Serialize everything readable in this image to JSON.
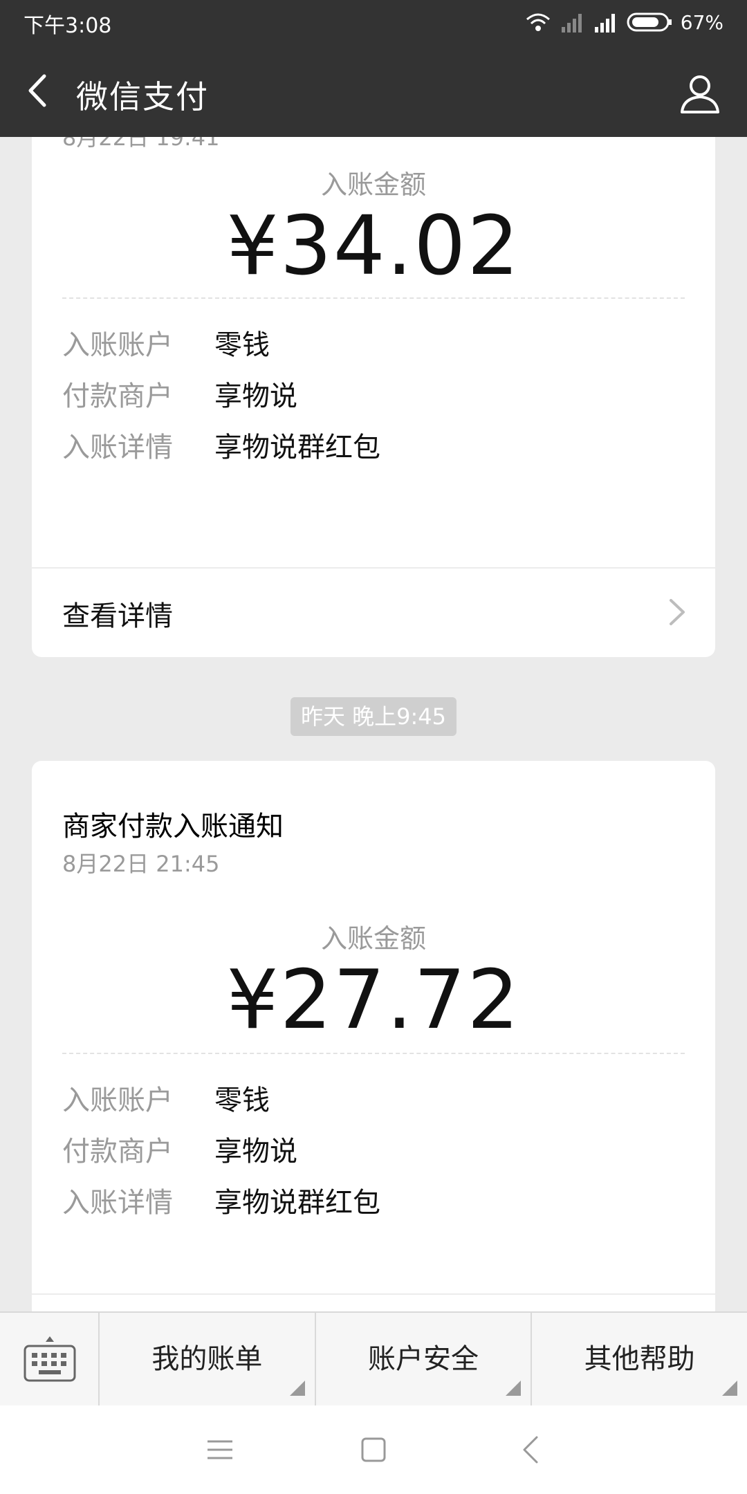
{
  "status": {
    "time": "下午3:08",
    "battery": "67%"
  },
  "header": {
    "title": "微信支付"
  },
  "cards": [
    {
      "partial_date": "8月22日 19:41",
      "amount_label": "入账金额",
      "amount": "¥34.02",
      "rows": [
        {
          "key": "入账账户",
          "value": "零钱"
        },
        {
          "key": "付款商户",
          "value": "享物说"
        },
        {
          "key": "入账详情",
          "value": "享物说群红包"
        }
      ],
      "detail_link": "查看详情"
    },
    {
      "title": "商家付款入账通知",
      "date": "8月22日 21:45",
      "amount_label": "入账金额",
      "amount": "¥27.72",
      "rows": [
        {
          "key": "入账账户",
          "value": "零钱"
        },
        {
          "key": "付款商户",
          "value": "享物说"
        },
        {
          "key": "入账详情",
          "value": "享物说群红包"
        }
      ]
    }
  ],
  "timestamp_pill": "昨天 晚上9:45",
  "menu": {
    "items": [
      "我的账单",
      "账户安全",
      "其他帮助"
    ]
  },
  "colors": {
    "bar": "#333333",
    "background": "#ebebeb",
    "muted_text": "#9a9a9a"
  }
}
